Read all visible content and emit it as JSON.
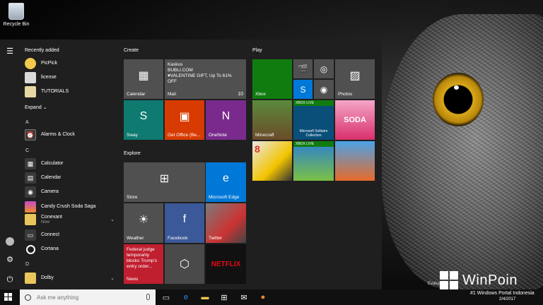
{
  "desktop": {
    "recycle_bin": "Recycle Bin"
  },
  "start_menu": {
    "recently_added_header": "Recently added",
    "expand_label": "Expand",
    "recent_apps": [
      {
        "label": "PicPick",
        "icon": "picpick-icon"
      },
      {
        "label": "license",
        "icon": "document-icon"
      },
      {
        "label": "TUTORIALS",
        "icon": "document-icon"
      }
    ],
    "letters": {
      "a": "A",
      "c": "C",
      "d": "D"
    },
    "apps": [
      {
        "label": "Alarms & Clock",
        "icon": "alarm-clock-icon"
      },
      {
        "label": "Calculator",
        "icon": "calculator-icon"
      },
      {
        "label": "Calendar",
        "icon": "calendar-icon"
      },
      {
        "label": "Camera",
        "icon": "camera-icon"
      },
      {
        "label": "Candy Crush Soda Saga",
        "icon": "candy-crush-icon"
      },
      {
        "label": "Conexant",
        "sub": "New",
        "icon": "folder-icon"
      },
      {
        "label": "Connect",
        "icon": "connect-icon"
      },
      {
        "label": "Cortana",
        "icon": "cortana-icon"
      },
      {
        "label": "Dolby",
        "icon": "folder-icon"
      }
    ],
    "groups": {
      "create": "Create",
      "play": "Play",
      "explore": "Explore"
    },
    "tiles": {
      "calendar": "Calendar",
      "mail": "Mail",
      "mail_sender": "Kaskus",
      "mail_from": "BUBLI.COM",
      "mail_subject": "♥VALENTINE GIFT, Up To 61% OFF",
      "mail_count": "10",
      "sway": "Sway",
      "office": "Get Office (Be...",
      "onenote": "OneNote",
      "xbox": "Xbox",
      "photos": "Photos",
      "minecraft": "Minecraft",
      "xbox_live_1": "XBOX LIVE",
      "xbox_live_2": "XBOX LIVE",
      "solitaire": "Microsoft Solitaire Collection",
      "soda": "SODA",
      "store": "Store",
      "edge": "Microsoft Edge",
      "weather": "Weather",
      "facebook": "Facebook",
      "twitter": "Twitter",
      "news": "News",
      "news_headline": "Federal judge temporarily blocks Trump's entry order...",
      "netflix": "NETFLIX"
    }
  },
  "taskbar": {
    "search_placeholder": "Ask me anything",
    "evaluation": "Evaluation",
    "watermark_brand": "WinPoin",
    "watermark_sub": "#1 Windows Portal Indonesia",
    "date": "2/4/2017"
  },
  "colors": {
    "tile_blue": "#2b72c8",
    "tile_grey": "#505050",
    "sway_green": "#0e7a70",
    "office_red": "#d83b01",
    "xbox_green": "#107c10",
    "news_red": "#c01f2f",
    "facebook_blue": "#3b5998",
    "edge_blue": "#0078d7"
  }
}
